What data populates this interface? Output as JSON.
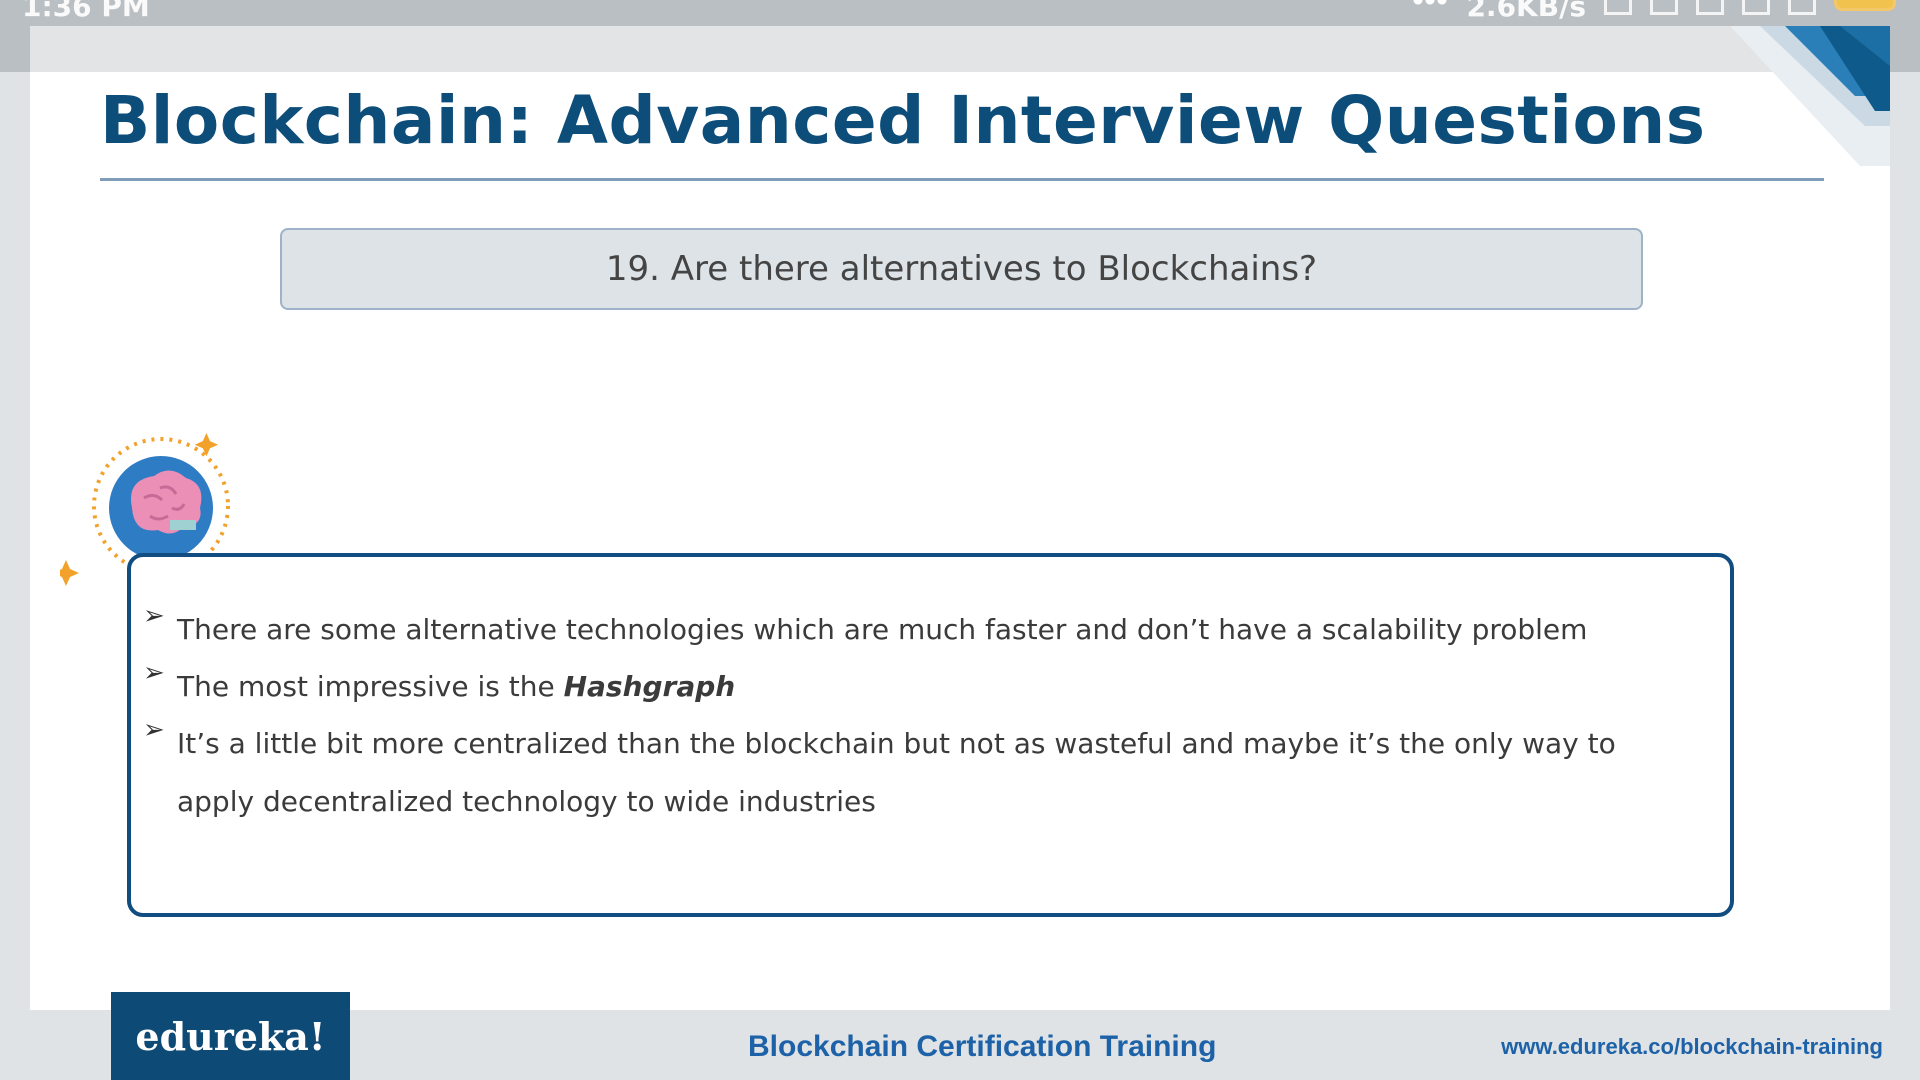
{
  "status_bar": {
    "time": "1:36 PM",
    "net_speed": "2.6KB/s"
  },
  "slide": {
    "title": "Blockchain: Advanced Interview Questions",
    "question": "19. Are there alternatives to Blockchains?",
    "bullets": [
      {
        "text": "There are some alternative technologies which are much faster and don’t have a scalability problem",
        "emphasis": ""
      },
      {
        "text": "The most impressive is the ",
        "emphasis": "Hashgraph"
      },
      {
        "text": "It’s a little bit more centralized than the blockchain but not as wasteful and maybe it’s the only way to apply decentralized technology to wide industries",
        "emphasis": ""
      }
    ],
    "bullet_marker": "➢"
  },
  "footer": {
    "logo": "edureka!",
    "course": "Blockchain Certification Training",
    "url": "www.edureka.co/blockchain-training"
  },
  "colors": {
    "title": "#0d4d7a",
    "accent": "#114d80",
    "footer_link": "#1d62a8"
  }
}
